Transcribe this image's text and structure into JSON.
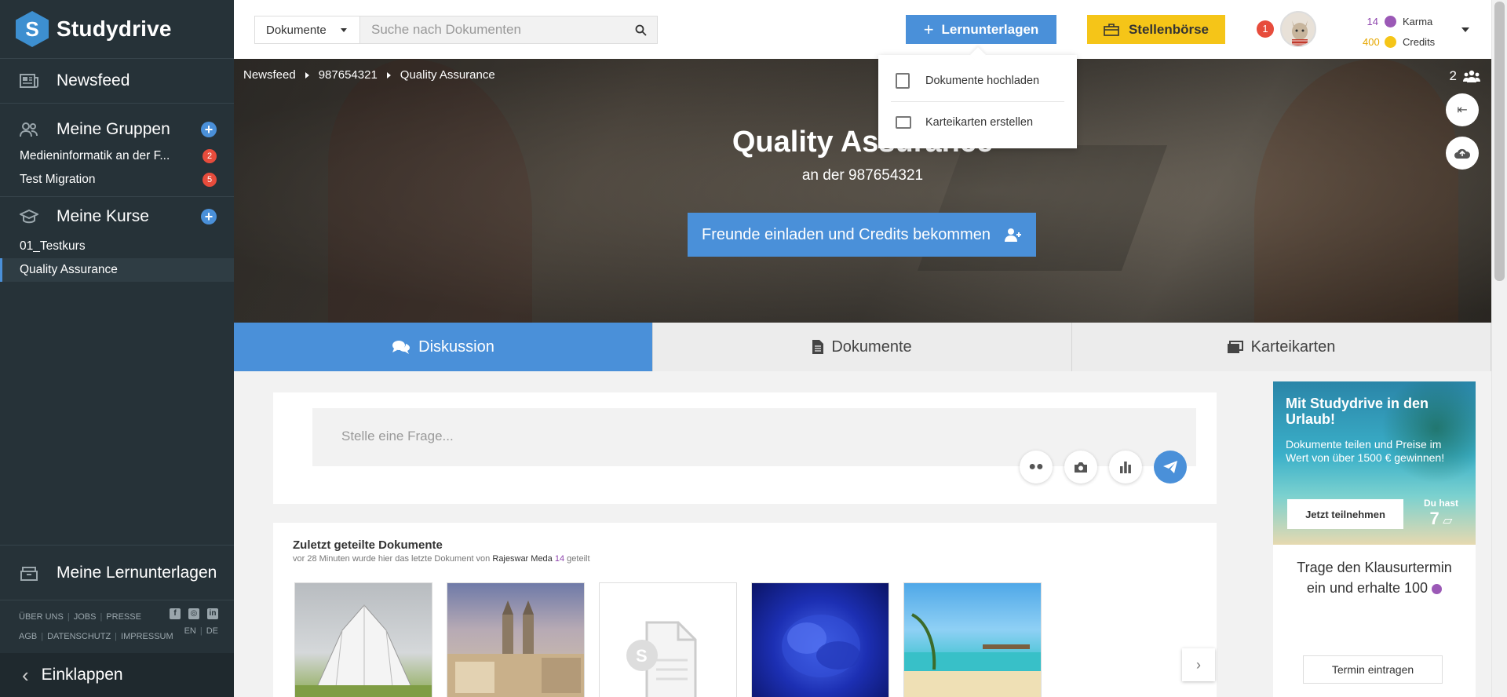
{
  "app": {
    "name": "Studydrive",
    "logo_letter": "S"
  },
  "sidebar": {
    "newsfeed": "Newsfeed",
    "groups": {
      "title": "Meine Gruppen",
      "items": [
        {
          "label": "Medieninformatik an der F...",
          "badge": "2"
        },
        {
          "label": "Test Migration",
          "badge": "5"
        }
      ]
    },
    "courses": {
      "title": "Meine Kurse",
      "items": [
        {
          "label": "01_Testkurs"
        },
        {
          "label": "Quality Assurance"
        }
      ]
    },
    "materials": "Meine Lernunterlagen",
    "footer": {
      "row1": [
        "ÜBER UNS",
        "JOBS",
        "PRESSE"
      ],
      "row2": [
        "AGB",
        "DATENSCHUTZ",
        "IMPRESSUM"
      ],
      "lang": [
        "EN",
        "DE"
      ],
      "social": [
        "facebook-icon",
        "instagram-icon",
        "linkedin-icon"
      ]
    },
    "collapse": "Einklappen"
  },
  "topbar": {
    "search_type": "Dokumente",
    "search_placeholder": "Suche nach Dokumenten",
    "lern_button": "Lernunterlagen",
    "job_button": "Stellenbörse",
    "notifications": "1",
    "karma_value": "14",
    "karma_label": "Karma",
    "credits_value": "400",
    "credits_label": "Credits"
  },
  "dropdown": {
    "items": [
      "Dokumente hochladen",
      "Karteikarten erstellen"
    ]
  },
  "hero": {
    "breadcrumb": [
      "Newsfeed",
      "987654321",
      "Quality Assurance"
    ],
    "members": "2",
    "title": "Quality Assurance",
    "subtitle": "an der 987654321",
    "invite_button": "Freunde einladen und Credits bekommen"
  },
  "tabs": [
    {
      "label": "Diskussion",
      "active": true
    },
    {
      "label": "Dokumente",
      "active": false
    },
    {
      "label": "Karteikarten",
      "active": false
    }
  ],
  "compose": {
    "placeholder": "Stelle eine Frage..."
  },
  "recent": {
    "title": "Zuletzt geteilte Dokumente",
    "meta_prefix": "vor 28 Minuten wurde hier das letzte Dokument von",
    "meta_user": "Rajeswar Meda",
    "meta_user_karma": "14",
    "meta_suffix": "geteilt"
  },
  "promo": {
    "title": "Mit Studydrive in den Urlaub!",
    "text": "Dokumente teilen und Preise im Wert von über 1500 € gewinnen!",
    "button": "Jetzt teilnehmen",
    "count_label": "Du hast",
    "count": "7"
  },
  "exam": {
    "text": "Trage den Klausurtermin ein und erhalte 100",
    "button": "Termin eintragen"
  },
  "colors": {
    "accent": "#4a90d9",
    "sidebar": "#263238",
    "job": "#f5c518",
    "badge": "#e74c3c",
    "karma": "#9b59b6"
  }
}
